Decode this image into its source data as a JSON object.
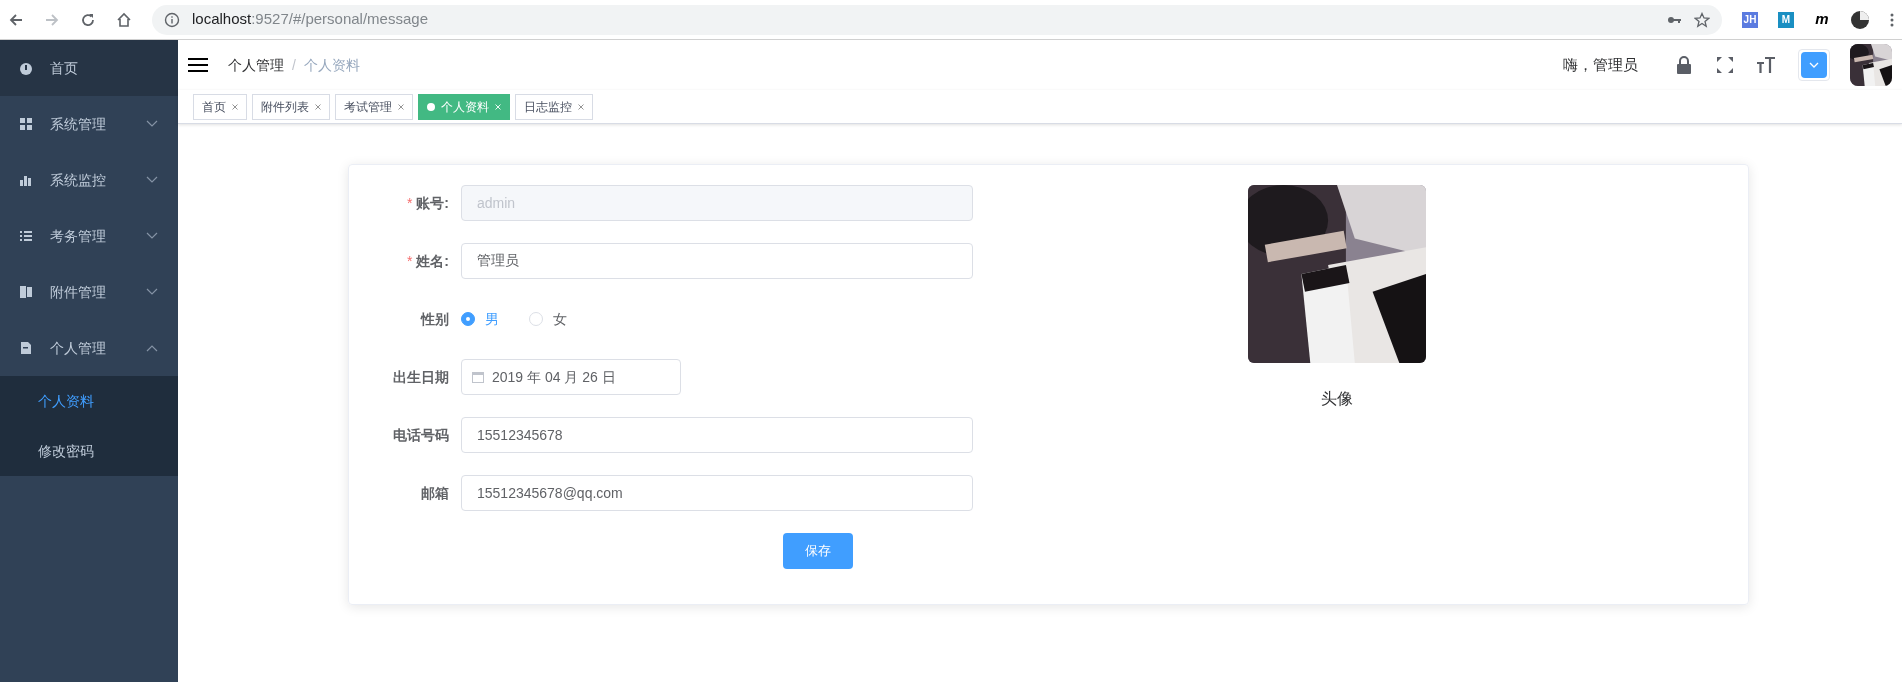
{
  "browser": {
    "url_host": "localhost",
    "url_rest": ":9527/#/personal/message",
    "extensions": [
      {
        "label": "JH",
        "color": "#5b7be0"
      },
      {
        "label": "M",
        "color": "#1a8fc2"
      },
      {
        "label": "m",
        "color": "#ffffff"
      }
    ]
  },
  "sidebar": {
    "items": [
      {
        "label": "首页",
        "kind": "link",
        "hovered": true
      },
      {
        "label": "系统管理",
        "kind": "menu",
        "expanded": false
      },
      {
        "label": "系统监控",
        "kind": "menu",
        "expanded": false
      },
      {
        "label": "考务管理",
        "kind": "menu",
        "expanded": false
      },
      {
        "label": "附件管理",
        "kind": "menu",
        "expanded": false
      },
      {
        "label": "个人管理",
        "kind": "menu",
        "expanded": true,
        "children": [
          {
            "label": "个人资料",
            "selected": true
          },
          {
            "label": "修改密码",
            "selected": false
          }
        ]
      }
    ]
  },
  "header": {
    "breadcrumb": [
      "个人管理",
      "个人资料"
    ],
    "breadcrumb_separator": "/",
    "greeting": "嗨，管理员"
  },
  "tabs": [
    {
      "label": "首页",
      "selected": false
    },
    {
      "label": "附件列表",
      "selected": false
    },
    {
      "label": "考试管理",
      "selected": false
    },
    {
      "label": "个人资料",
      "selected": true
    },
    {
      "label": "日志监控",
      "selected": false
    }
  ],
  "form": {
    "fields": [
      {
        "label": "账号:",
        "required_mark": "*",
        "kind": "text",
        "value": "admin",
        "disabled": true
      },
      {
        "label": "姓名:",
        "required_mark": "*",
        "kind": "text",
        "value": "管理员",
        "disabled": false
      },
      {
        "label": "性别",
        "kind": "radio",
        "options": [
          {
            "label": "男",
            "selected": true
          },
          {
            "label": "女",
            "selected": false
          }
        ]
      },
      {
        "label": "出生日期",
        "kind": "date",
        "value": "2019 年 04 月 26 日"
      },
      {
        "label": "电话号码",
        "kind": "text",
        "value": "15512345678",
        "disabled": false
      },
      {
        "label": "邮箱",
        "kind": "text",
        "value": "15512345678@qq.com",
        "disabled": false
      }
    ],
    "save": "保存"
  },
  "avatar": {
    "caption": "头像"
  }
}
